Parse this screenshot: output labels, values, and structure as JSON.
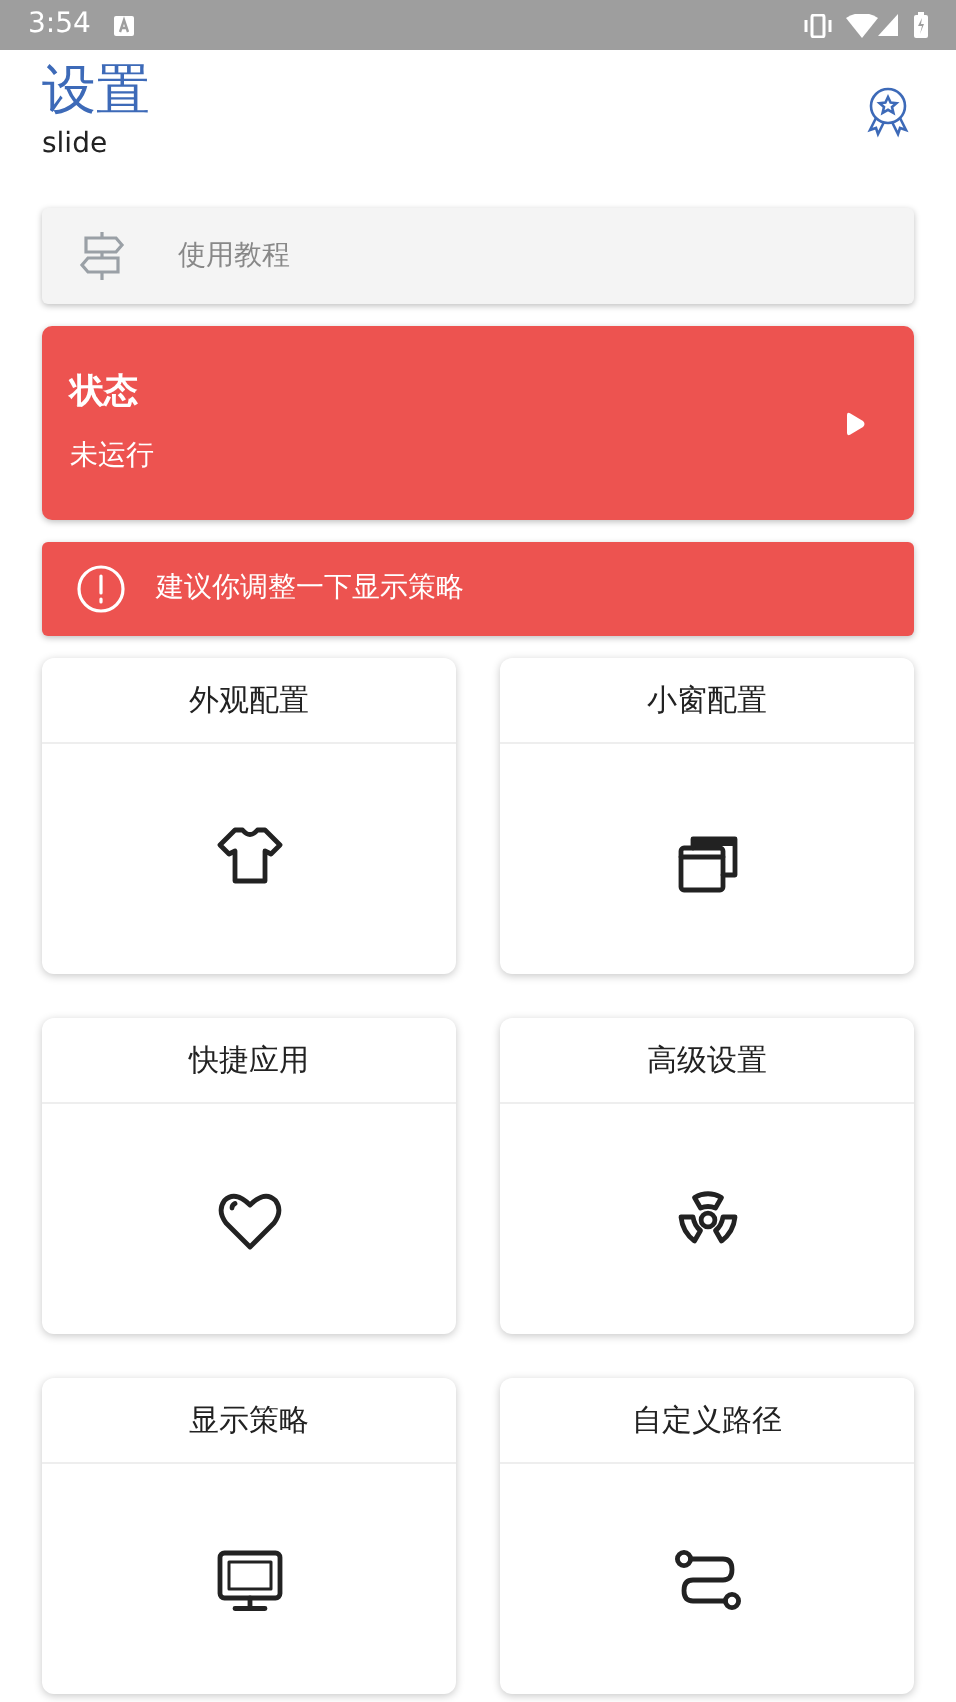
{
  "status_bar": {
    "time": "3:54"
  },
  "header": {
    "title": "设置",
    "subtitle": "slide"
  },
  "tutorial": {
    "label": "使用教程"
  },
  "status_card": {
    "title": "状态",
    "state": "未运行"
  },
  "warning": {
    "text": "建议你调整一下显示策略"
  },
  "cards": [
    {
      "title": "外观配置"
    },
    {
      "title": "小窗配置"
    },
    {
      "title": "快捷应用"
    },
    {
      "title": "高级设置"
    },
    {
      "title": "显示策略"
    },
    {
      "title": "自定义路径"
    }
  ]
}
